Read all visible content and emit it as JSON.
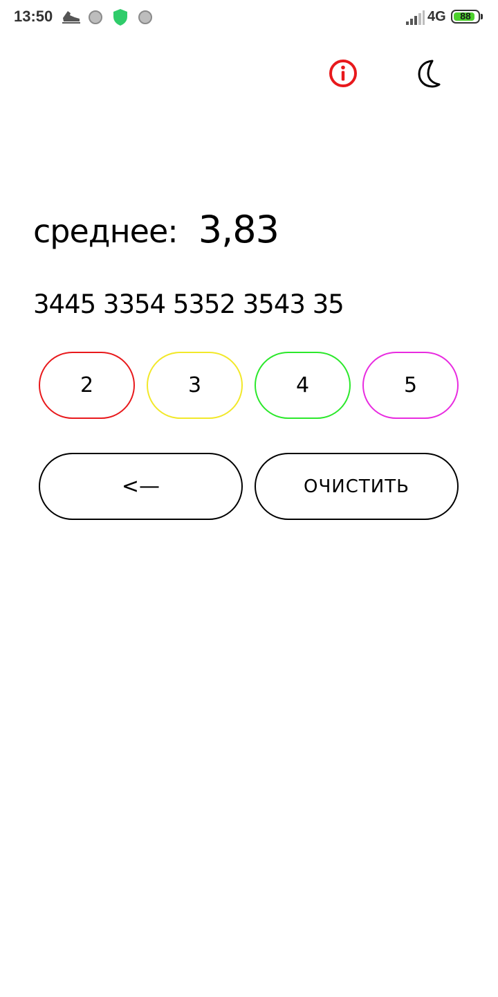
{
  "status_bar": {
    "time": "13:50",
    "network": "4G",
    "battery_level": "88",
    "battery_fraction": 0.88,
    "icons": [
      "running-shoe-icon",
      "circle-icon",
      "shield-icon",
      "circle-icon",
      "signal-icon",
      "battery-icon"
    ],
    "shield_color": "#2fcc6a",
    "battery_color": "#4cd12c"
  },
  "toolbar": {
    "info_icon": "info-icon",
    "info_color": "#e8191c",
    "theme_icon": "moon-icon"
  },
  "average": {
    "label": "среднее:",
    "value": "3,83"
  },
  "grades_entered": "3445 3354 5352 3543 35",
  "grade_buttons": [
    {
      "label": "2",
      "color": "#e8191c"
    },
    {
      "label": "3",
      "color": "#f2e829"
    },
    {
      "label": "4",
      "color": "#2be82b"
    },
    {
      "label": "5",
      "color": "#e82be0"
    }
  ],
  "actions": {
    "backspace_label": "<—",
    "clear_label": "ОЧИСТИТЬ"
  }
}
